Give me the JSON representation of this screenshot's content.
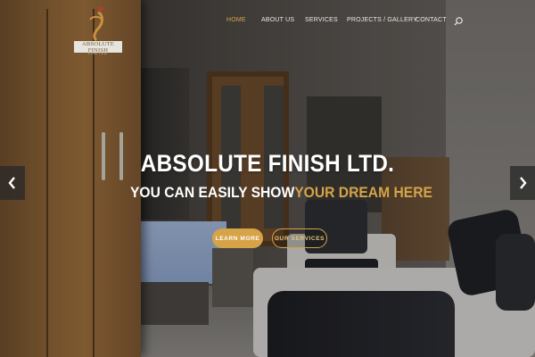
{
  "brand": {
    "logo_name": "ABSOLUTE FINISH",
    "logo_sub": "LIMITED"
  },
  "nav": {
    "items": [
      {
        "label": "HOME",
        "active": true
      },
      {
        "label": "ABOUT US",
        "active": false
      },
      {
        "label": "SERVICES",
        "active": false
      },
      {
        "label": "PROJECTS / GALLERY",
        "active": false
      },
      {
        "label": "CONTACT",
        "active": false
      }
    ],
    "search_icon": "search-icon"
  },
  "hero": {
    "title": "ABSOLUTE FINISH LTD.",
    "subtitle_white": "YOU CAN EASILY SHOW",
    "subtitle_gold": "YOUR DREAM HERE",
    "primary_button": "LEARN MORE",
    "secondary_button": "OUR SERVICES"
  },
  "slider": {
    "prev_icon": "chevron-left-icon",
    "next_icon": "chevron-right-icon"
  },
  "colors": {
    "accent": "#d6a348",
    "nav_text": "#e9e9e9",
    "text": "#ffffff"
  }
}
